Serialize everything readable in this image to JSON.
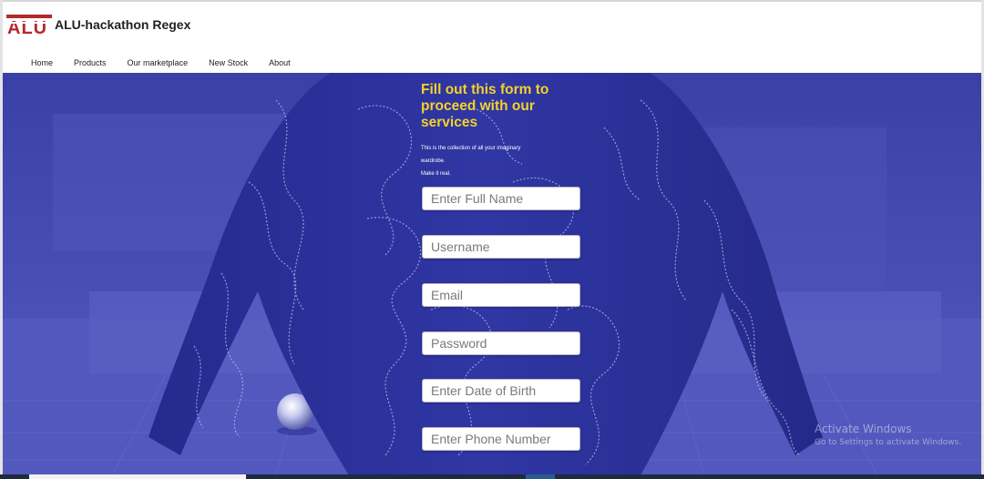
{
  "header": {
    "logo_text": "ALU",
    "brand": "ALU-hackathon Regex",
    "nav": [
      {
        "label": "Home"
      },
      {
        "label": "Products"
      },
      {
        "label": "Our marketplace"
      },
      {
        "label": "New Stock"
      },
      {
        "label": "About"
      }
    ]
  },
  "form": {
    "title": "Fill out this form to proceed with our services",
    "description_lines": [
      "This is the collection of all your imaginary",
      "wardrobe.",
      "Make it real."
    ],
    "fields": [
      {
        "placeholder": "Enter Full Name",
        "value": ""
      },
      {
        "placeholder": "Username",
        "value": ""
      },
      {
        "placeholder": "Email",
        "value": ""
      },
      {
        "placeholder": "Password",
        "value": ""
      },
      {
        "placeholder": "Enter Date of Birth",
        "value": ""
      },
      {
        "placeholder": "Enter Phone Number",
        "value": ""
      }
    ]
  },
  "watermark": {
    "line1": "Activate Windows",
    "line2": "Go to Settings to activate Windows."
  },
  "colors": {
    "hero_overlay": "#3f46b0",
    "title": "#f3d22a",
    "logo_red": "#b42a2a"
  }
}
